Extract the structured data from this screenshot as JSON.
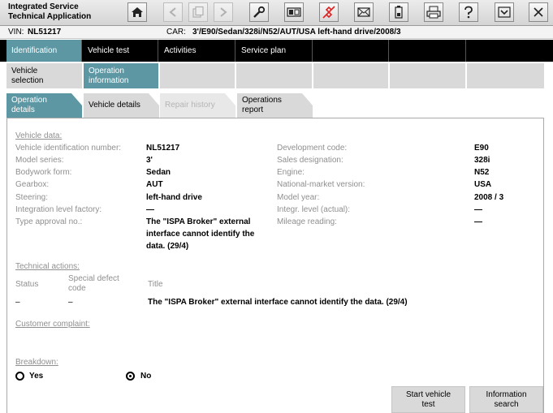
{
  "app": {
    "title_line1": "Integrated Service",
    "title_line2": "Technical Application"
  },
  "toolbar": {
    "icons": [
      "home-icon",
      "back-icon",
      "copy-icon",
      "forward-icon",
      "wrench-icon",
      "display-icon",
      "connection-icon",
      "mail-icon",
      "battery-icon",
      "print-icon",
      "help-icon",
      "dropdown-icon",
      "close-icon"
    ]
  },
  "vehicle_bar": {
    "vin_label": "VIN:",
    "vin_value": "NL51217",
    "car_label": "CAR:",
    "car_value": "3'/E90/Sedan/328i/N52/AUT/USA left-hand drive/2008/3"
  },
  "main_tabs": [
    "Identification",
    "Vehicle test",
    "Activities",
    "Service plan"
  ],
  "sub_tabs": [
    {
      "line1": "Vehicle",
      "line2": "selection"
    },
    {
      "line1": "Operation",
      "line2": "information"
    }
  ],
  "detail_tabs": [
    {
      "line1": "Operation",
      "line2": "details"
    },
    {
      "line1": "Vehicle details",
      "line2": ""
    },
    {
      "line1": "Repair history",
      "line2": ""
    },
    {
      "line1": "Operations",
      "line2": "report"
    }
  ],
  "vehicle_data": {
    "heading": "Vehicle data:",
    "left": [
      {
        "label": "Vehicle identification number:",
        "value": "NL51217"
      },
      {
        "label": "Model series:",
        "value": "3'"
      },
      {
        "label": "Bodywork form:",
        "value": "Sedan"
      },
      {
        "label": "Gearbox:",
        "value": "AUT"
      },
      {
        "label": "Steering:",
        "value": "left-hand drive"
      },
      {
        "label": "Integration level factory:",
        "value": "—"
      },
      {
        "label": "Type approval no.:",
        "value_line1": "The \"ISPA Broker\" external",
        "value_line2": "interface cannot identify the",
        "value_line3": "data. (29/4)"
      }
    ],
    "right": [
      {
        "label": "Development code:",
        "value": "E90"
      },
      {
        "label": "Sales designation:",
        "value": "328i"
      },
      {
        "label": "Engine:",
        "value": "N52"
      },
      {
        "label": "National-market version:",
        "value": "USA"
      },
      {
        "label": "Model year:",
        "value": "2008 / 3"
      },
      {
        "label": "Integr. level (actual):",
        "value": "—"
      },
      {
        "label": "Mileage reading:",
        "value": "—"
      }
    ]
  },
  "technical_actions": {
    "heading": "Technical actions:",
    "col_status": "Status",
    "col_defect_line1": "Special defect",
    "col_defect_line2": "code",
    "col_title": "Title",
    "row_status": "–",
    "row_defect": "–",
    "row_title": "The \"ISPA Broker\" external interface cannot identify the data. (29/4)"
  },
  "customer_complaint": {
    "heading": "Customer complaint:"
  },
  "breakdown": {
    "heading": "Breakdown:",
    "yes_label": "Yes",
    "no_label": "No",
    "selected": "No"
  },
  "buttons": {
    "start_test_line1": "Start vehicle",
    "start_test_line2": "test",
    "info_search_line1": "Information",
    "info_search_line2": "search"
  }
}
